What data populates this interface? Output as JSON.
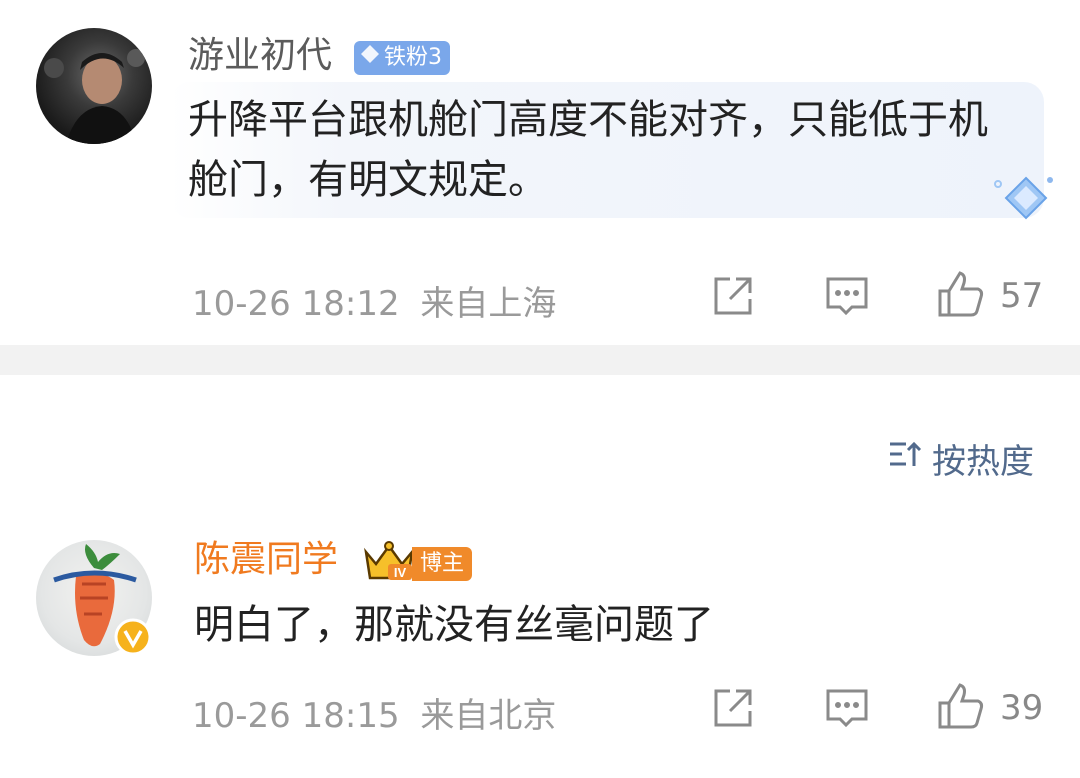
{
  "comments": [
    {
      "username": "游业初代",
      "badge": "铁粉3",
      "text": "升降平台跟机舱门高度不能对齐，只能低于机舱门，有明文规定。",
      "time": "10-26 18:12",
      "location": "来自上海",
      "likes": "57"
    },
    {
      "username": "陈震同学",
      "badge": "博主",
      "text": "明白了，那就没有丝毫问题了",
      "time": "10-26 18:15",
      "location": "来自北京",
      "likes": "39"
    }
  ],
  "sort": {
    "label": "按热度"
  },
  "colors": {
    "accent_orange": "#f07a1f",
    "fan_badge": "#7aa7ea",
    "link_blue": "#526a8c"
  }
}
